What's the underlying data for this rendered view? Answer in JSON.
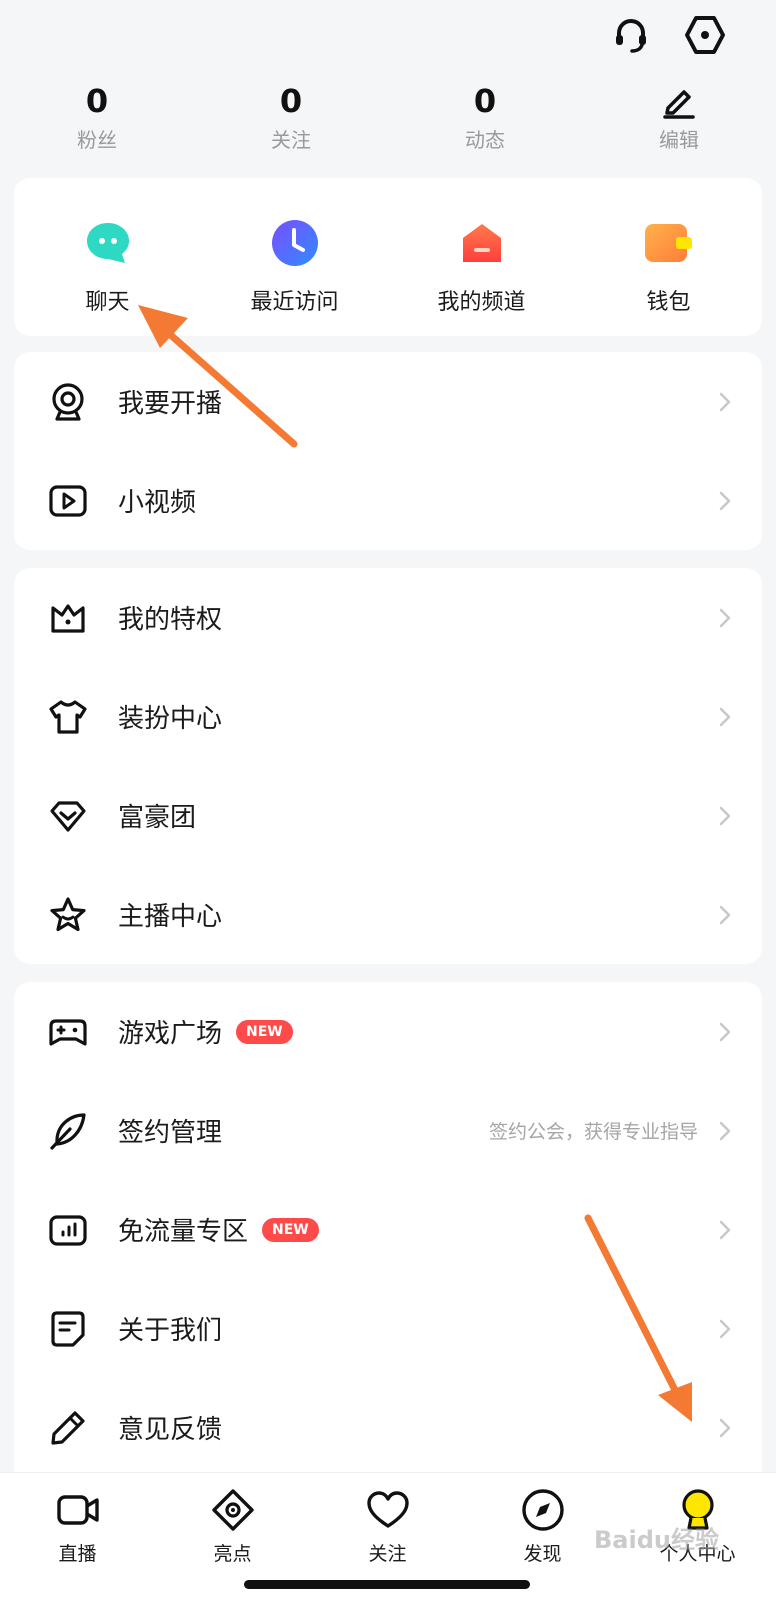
{
  "top_icons": [
    "headset-icon",
    "hexagon-settings-icon"
  ],
  "stats": [
    {
      "value": "0",
      "label": "粉丝"
    },
    {
      "value": "0",
      "label": "关注"
    },
    {
      "value": "0",
      "label": "动态"
    },
    {
      "label": "编辑",
      "icon": "pen-icon"
    }
  ],
  "quick_actions": [
    {
      "label": "聊天",
      "icon": "chat-bubble-icon",
      "color": "#2ed8c3"
    },
    {
      "label": "最近访问",
      "icon": "clock-icon",
      "color": "#4a68ff"
    },
    {
      "label": "我的频道",
      "icon": "house-icon",
      "color": "#ff5a45"
    },
    {
      "label": "钱包",
      "icon": "wallet-icon",
      "color": "#ffa03c"
    }
  ],
  "group1": [
    {
      "label": "我要开播",
      "icon": "webcam-icon"
    },
    {
      "label": "小视频",
      "icon": "video-play-icon"
    }
  ],
  "group2": [
    {
      "label": "我的特权",
      "icon": "crown-icon"
    },
    {
      "label": "装扮中心",
      "icon": "tshirt-icon"
    },
    {
      "label": "富豪团",
      "icon": "diamond-icon"
    },
    {
      "label": "主播中心",
      "icon": "star-icon"
    }
  ],
  "group3": [
    {
      "label": "游戏广场",
      "icon": "gamepad-icon",
      "badge": "NEW"
    },
    {
      "label": "签约管理",
      "icon": "feather-icon",
      "hint": "签约公会，获得专业指导"
    },
    {
      "label": "免流量专区",
      "icon": "signal-bars-icon",
      "badge": "NEW"
    },
    {
      "label": "关于我们",
      "icon": "note-icon"
    },
    {
      "label": "意见反馈",
      "icon": "pencil-icon"
    }
  ],
  "tabs": [
    {
      "label": "直播",
      "icon": "video-camera-icon"
    },
    {
      "label": "亮点",
      "icon": "eye-diamond-icon"
    },
    {
      "label": "关注",
      "icon": "heart-icon"
    },
    {
      "label": "发现",
      "icon": "compass-icon"
    },
    {
      "label": "个人中心",
      "icon": "person-active-icon"
    }
  ],
  "watermark": "Baidu经验",
  "colors": {
    "accent_yellow": "#ffe600",
    "badge_red": "#ff4a4a",
    "annotation_orange": "#f47a33"
  }
}
